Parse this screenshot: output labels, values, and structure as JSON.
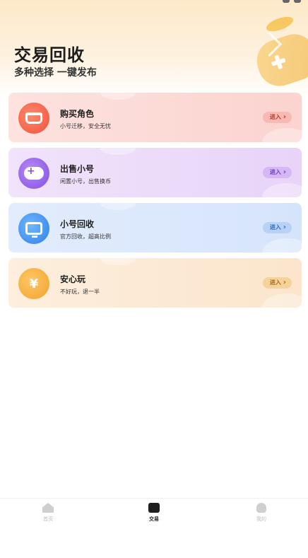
{
  "header": {
    "title": "交易回收",
    "subtitle": "多种选择 一键发布"
  },
  "cards": [
    {
      "key": "buy",
      "title": "购买角色",
      "desc": "小号迁移，安全无忧",
      "button": "进入",
      "icon": "basket-icon"
    },
    {
      "key": "sell",
      "title": "出售小号",
      "desc": "闲置小号，出售换币",
      "button": "进入",
      "icon": "gamepad-icon"
    },
    {
      "key": "recycle",
      "title": "小号回收",
      "desc": "官方回收，超高比例",
      "button": "进入",
      "icon": "monitor-recycle-icon"
    },
    {
      "key": "safe",
      "title": "安心玩",
      "desc": "不好玩，退一半",
      "button": "进入",
      "icon": "yuan-shield-icon"
    }
  ],
  "safe_icon_symbol": "¥",
  "tabbar": {
    "items": [
      {
        "label": "首页",
        "icon": "home-icon"
      },
      {
        "label": "交易",
        "icon": "trade-icon",
        "active": true
      },
      {
        "label": "我的",
        "icon": "profile-icon"
      }
    ]
  },
  "colors": {
    "buy": "#f0503c",
    "sell": "#7f4fe2",
    "recycle": "#2e7fe8",
    "safe": "#f0a22c"
  }
}
